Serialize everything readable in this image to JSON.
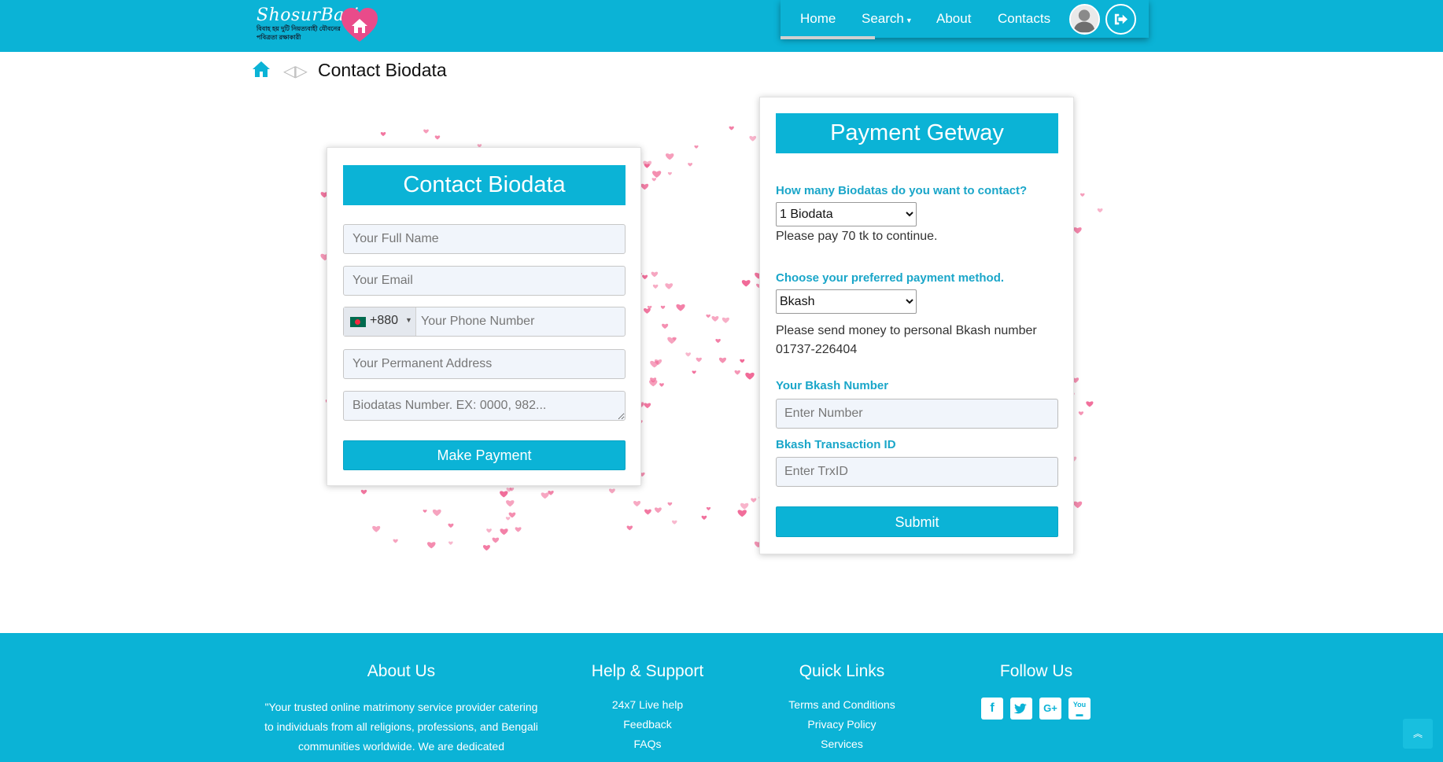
{
  "brand": {
    "name": "ShosurBari",
    "tagline": "বিবাহ হয় দুটি নিয়ত্যবাহী যৌবনের পবিত্রতা রক্ষাকারী"
  },
  "nav": {
    "items": [
      "Home",
      "Search",
      "About",
      "Contacts"
    ],
    "active": "Home"
  },
  "breadcrumb": {
    "separator": "◁▷",
    "title": "Contact Biodata"
  },
  "contact_form": {
    "title": "Contact Biodata",
    "full_name_placeholder": "Your Full Name",
    "email_placeholder": "Your Email",
    "dial_code": "+880",
    "phone_placeholder": "Your Phone Number",
    "address_placeholder": "Your Permanent Address",
    "biodata_placeholder": "Biodatas Number. EX: 0000, 982...",
    "submit_label": "Make Payment"
  },
  "payment": {
    "title": "Payment Getway",
    "count_label": "How many Biodatas do you want to contact?",
    "count_selected": "1 Biodata",
    "count_note": "Please pay 70 tk to continue.",
    "method_label": "Choose your preferred payment method.",
    "method_selected": "Bkash",
    "method_note": "Please send money to personal Bkash number 01737-226404",
    "number_label": "Your Bkash Number",
    "number_placeholder": "Enter Number",
    "trx_label": "Bkash Transaction ID",
    "trx_placeholder": "Enter TrxID",
    "submit_label": "Submit"
  },
  "footer": {
    "about_title": "About Us",
    "about_text": "\"Your trusted online matrimony service provider catering to individuals from all religions, professions, and Bengali communities worldwide. We are dedicated",
    "help_title": "Help & Support",
    "help_links": [
      "24x7 Live help",
      "Feedback",
      "FAQs"
    ],
    "quick_title": "Quick Links",
    "quick_links": [
      "Terms and Conditions",
      "Privacy Policy",
      "Services"
    ],
    "follow_title": "Follow Us",
    "social_icons": [
      "facebook-icon",
      "twitter-icon",
      "google-plus-icon",
      "youtube-icon"
    ]
  },
  "colors": {
    "primary": "#0bb3d6",
    "label": "#1aa6c9",
    "heart": "#f06292"
  }
}
